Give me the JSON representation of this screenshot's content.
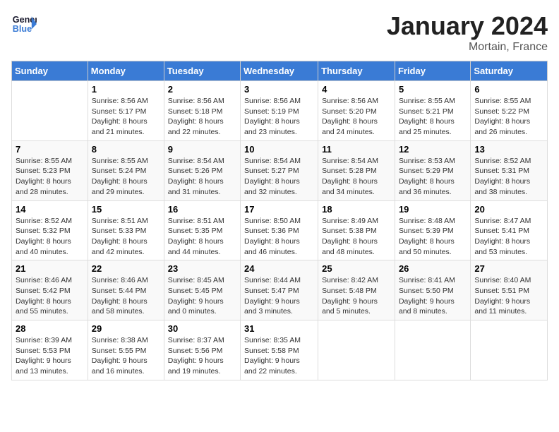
{
  "header": {
    "logo_line1": "General",
    "logo_line2": "Blue",
    "month": "January 2024",
    "location": "Mortain, France"
  },
  "days_of_week": [
    "Sunday",
    "Monday",
    "Tuesday",
    "Wednesday",
    "Thursday",
    "Friday",
    "Saturday"
  ],
  "weeks": [
    [
      {
        "day": "",
        "sunrise": "",
        "sunset": "",
        "daylight": ""
      },
      {
        "day": "1",
        "sunrise": "Sunrise: 8:56 AM",
        "sunset": "Sunset: 5:17 PM",
        "daylight": "Daylight: 8 hours and 21 minutes."
      },
      {
        "day": "2",
        "sunrise": "Sunrise: 8:56 AM",
        "sunset": "Sunset: 5:18 PM",
        "daylight": "Daylight: 8 hours and 22 minutes."
      },
      {
        "day": "3",
        "sunrise": "Sunrise: 8:56 AM",
        "sunset": "Sunset: 5:19 PM",
        "daylight": "Daylight: 8 hours and 23 minutes."
      },
      {
        "day": "4",
        "sunrise": "Sunrise: 8:56 AM",
        "sunset": "Sunset: 5:20 PM",
        "daylight": "Daylight: 8 hours and 24 minutes."
      },
      {
        "day": "5",
        "sunrise": "Sunrise: 8:55 AM",
        "sunset": "Sunset: 5:21 PM",
        "daylight": "Daylight: 8 hours and 25 minutes."
      },
      {
        "day": "6",
        "sunrise": "Sunrise: 8:55 AM",
        "sunset": "Sunset: 5:22 PM",
        "daylight": "Daylight: 8 hours and 26 minutes."
      }
    ],
    [
      {
        "day": "7",
        "sunrise": "Sunrise: 8:55 AM",
        "sunset": "Sunset: 5:23 PM",
        "daylight": "Daylight: 8 hours and 28 minutes."
      },
      {
        "day": "8",
        "sunrise": "Sunrise: 8:55 AM",
        "sunset": "Sunset: 5:24 PM",
        "daylight": "Daylight: 8 hours and 29 minutes."
      },
      {
        "day": "9",
        "sunrise": "Sunrise: 8:54 AM",
        "sunset": "Sunset: 5:26 PM",
        "daylight": "Daylight: 8 hours and 31 minutes."
      },
      {
        "day": "10",
        "sunrise": "Sunrise: 8:54 AM",
        "sunset": "Sunset: 5:27 PM",
        "daylight": "Daylight: 8 hours and 32 minutes."
      },
      {
        "day": "11",
        "sunrise": "Sunrise: 8:54 AM",
        "sunset": "Sunset: 5:28 PM",
        "daylight": "Daylight: 8 hours and 34 minutes."
      },
      {
        "day": "12",
        "sunrise": "Sunrise: 8:53 AM",
        "sunset": "Sunset: 5:29 PM",
        "daylight": "Daylight: 8 hours and 36 minutes."
      },
      {
        "day": "13",
        "sunrise": "Sunrise: 8:52 AM",
        "sunset": "Sunset: 5:31 PM",
        "daylight": "Daylight: 8 hours and 38 minutes."
      }
    ],
    [
      {
        "day": "14",
        "sunrise": "Sunrise: 8:52 AM",
        "sunset": "Sunset: 5:32 PM",
        "daylight": "Daylight: 8 hours and 40 minutes."
      },
      {
        "day": "15",
        "sunrise": "Sunrise: 8:51 AM",
        "sunset": "Sunset: 5:33 PM",
        "daylight": "Daylight: 8 hours and 42 minutes."
      },
      {
        "day": "16",
        "sunrise": "Sunrise: 8:51 AM",
        "sunset": "Sunset: 5:35 PM",
        "daylight": "Daylight: 8 hours and 44 minutes."
      },
      {
        "day": "17",
        "sunrise": "Sunrise: 8:50 AM",
        "sunset": "Sunset: 5:36 PM",
        "daylight": "Daylight: 8 hours and 46 minutes."
      },
      {
        "day": "18",
        "sunrise": "Sunrise: 8:49 AM",
        "sunset": "Sunset: 5:38 PM",
        "daylight": "Daylight: 8 hours and 48 minutes."
      },
      {
        "day": "19",
        "sunrise": "Sunrise: 8:48 AM",
        "sunset": "Sunset: 5:39 PM",
        "daylight": "Daylight: 8 hours and 50 minutes."
      },
      {
        "day": "20",
        "sunrise": "Sunrise: 8:47 AM",
        "sunset": "Sunset: 5:41 PM",
        "daylight": "Daylight: 8 hours and 53 minutes."
      }
    ],
    [
      {
        "day": "21",
        "sunrise": "Sunrise: 8:46 AM",
        "sunset": "Sunset: 5:42 PM",
        "daylight": "Daylight: 8 hours and 55 minutes."
      },
      {
        "day": "22",
        "sunrise": "Sunrise: 8:46 AM",
        "sunset": "Sunset: 5:44 PM",
        "daylight": "Daylight: 8 hours and 58 minutes."
      },
      {
        "day": "23",
        "sunrise": "Sunrise: 8:45 AM",
        "sunset": "Sunset: 5:45 PM",
        "daylight": "Daylight: 9 hours and 0 minutes."
      },
      {
        "day": "24",
        "sunrise": "Sunrise: 8:44 AM",
        "sunset": "Sunset: 5:47 PM",
        "daylight": "Daylight: 9 hours and 3 minutes."
      },
      {
        "day": "25",
        "sunrise": "Sunrise: 8:42 AM",
        "sunset": "Sunset: 5:48 PM",
        "daylight": "Daylight: 9 hours and 5 minutes."
      },
      {
        "day": "26",
        "sunrise": "Sunrise: 8:41 AM",
        "sunset": "Sunset: 5:50 PM",
        "daylight": "Daylight: 9 hours and 8 minutes."
      },
      {
        "day": "27",
        "sunrise": "Sunrise: 8:40 AM",
        "sunset": "Sunset: 5:51 PM",
        "daylight": "Daylight: 9 hours and 11 minutes."
      }
    ],
    [
      {
        "day": "28",
        "sunrise": "Sunrise: 8:39 AM",
        "sunset": "Sunset: 5:53 PM",
        "daylight": "Daylight: 9 hours and 13 minutes."
      },
      {
        "day": "29",
        "sunrise": "Sunrise: 8:38 AM",
        "sunset": "Sunset: 5:55 PM",
        "daylight": "Daylight: 9 hours and 16 minutes."
      },
      {
        "day": "30",
        "sunrise": "Sunrise: 8:37 AM",
        "sunset": "Sunset: 5:56 PM",
        "daylight": "Daylight: 9 hours and 19 minutes."
      },
      {
        "day": "31",
        "sunrise": "Sunrise: 8:35 AM",
        "sunset": "Sunset: 5:58 PM",
        "daylight": "Daylight: 9 hours and 22 minutes."
      },
      {
        "day": "",
        "sunrise": "",
        "sunset": "",
        "daylight": ""
      },
      {
        "day": "",
        "sunrise": "",
        "sunset": "",
        "daylight": ""
      },
      {
        "day": "",
        "sunrise": "",
        "sunset": "",
        "daylight": ""
      }
    ]
  ]
}
